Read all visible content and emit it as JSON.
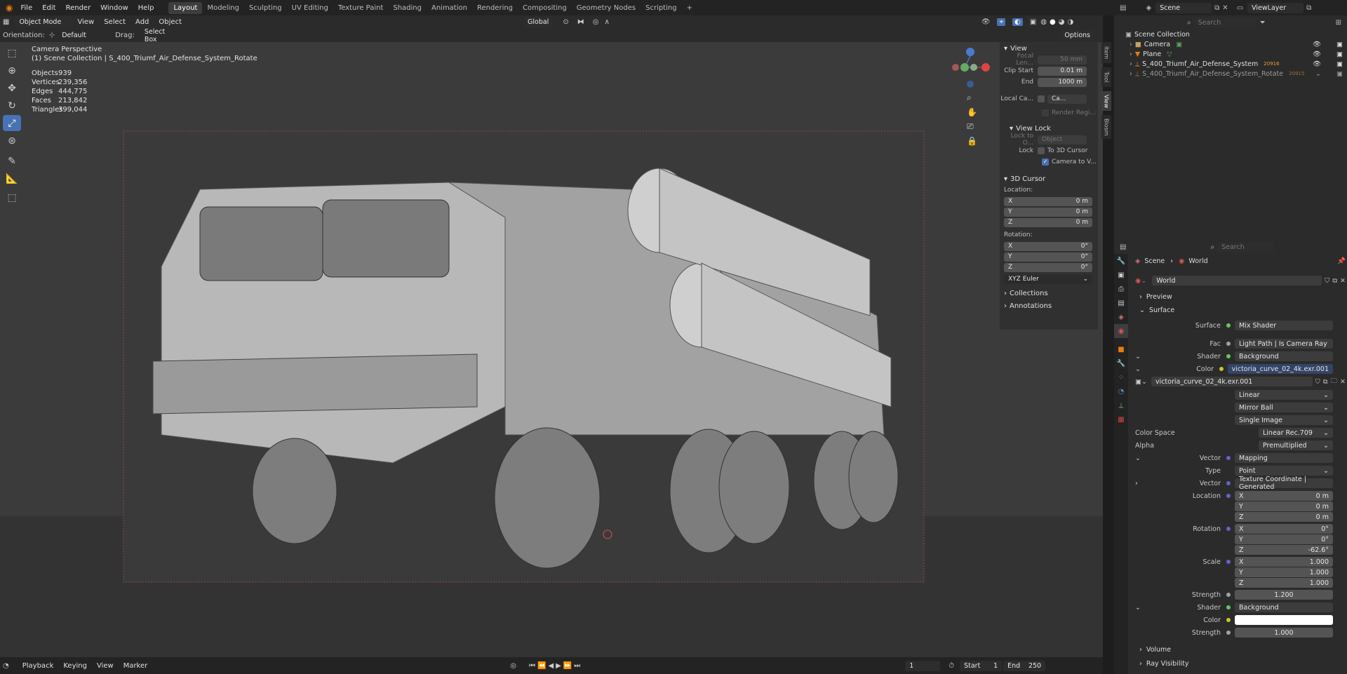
{
  "topbar": {
    "menus": [
      "File",
      "Edit",
      "Render",
      "Window",
      "Help"
    ],
    "workspaces": [
      "Layout",
      "Modeling",
      "Sculpting",
      "UV Editing",
      "Texture Paint",
      "Shading",
      "Animation",
      "Rendering",
      "Compositing",
      "Geometry Nodes",
      "Scripting"
    ],
    "active_workspace": "Layout",
    "scene": "Scene",
    "view_layer": "ViewLayer",
    "search_placeholder": "Search"
  },
  "viewport_header": {
    "mode": "Object Mode",
    "menus": [
      "View",
      "Select",
      "Add",
      "Object"
    ],
    "transform": "Global",
    "orientation_label": "Orientation:",
    "orientation": "Default",
    "drag_label": "Drag:",
    "drag": "Select Box",
    "options": "Options"
  },
  "overlay": {
    "line1": "Camera Perspective",
    "line2": "(1) Scene Collection | S_400_Triumf_Air_Defense_System_Rotate",
    "stats": [
      {
        "label": "Objects",
        "value": "939"
      },
      {
        "label": "Vertices",
        "value": "239,356"
      },
      {
        "label": "Edges",
        "value": "444,775"
      },
      {
        "label": "Faces",
        "value": "213,842"
      },
      {
        "label": "Triangles",
        "value": "399,044"
      }
    ]
  },
  "npanel": {
    "view_title": "View",
    "focal_label": "Focal Len...",
    "focal": "50 mm",
    "clip_start_label": "Clip Start",
    "clip_start": "0.01 m",
    "end_label": "End",
    "end": "1000 m",
    "local_cam_label": "Local Ca...",
    "local_cam_value": "Ca...",
    "render_region": "Render Regi...",
    "view_lock_title": "View Lock",
    "lock_to_label": "Lock to O...",
    "lock_to_value": "Object",
    "lock_label": "Lock",
    "to_3d_cursor": "To 3D Cursor",
    "camera_to_view": "Camera to V...",
    "cursor_title": "3D Cursor",
    "location_label": "Location:",
    "loc": [
      {
        "axis": "X",
        "v": "0 m"
      },
      {
        "axis": "Y",
        "v": "0 m"
      },
      {
        "axis": "Z",
        "v": "0 m"
      }
    ],
    "rotation_label": "Rotation:",
    "rot": [
      {
        "axis": "X",
        "v": "0°"
      },
      {
        "axis": "Y",
        "v": "0°"
      },
      {
        "axis": "Z",
        "v": "0°"
      }
    ],
    "rot_mode": "XYZ Euler",
    "collections": "Collections",
    "annotations": "Annotations",
    "tabs": [
      "Item",
      "Tool",
      "View",
      "Blosm"
    ]
  },
  "outliner": {
    "root": "Scene Collection",
    "items": [
      {
        "name": "Camera"
      },
      {
        "name": "Plane"
      },
      {
        "name": "S_400_Triumf_Air_Defense_System",
        "badge": "20916"
      },
      {
        "name": "S_400_Triumf_Air_Defense_System_Rotate",
        "badge": "20915"
      }
    ]
  },
  "properties": {
    "breadcrumb_scene": "Scene",
    "breadcrumb_world": "World",
    "world_name": "World",
    "preview": "Preview",
    "surface": "Surface",
    "surface_label": "Surface",
    "surface_value": "Mix Shader",
    "fac_label": "Fac",
    "fac_value": "Light Path | Is Camera Ray",
    "shader_label": "Shader",
    "shader_value": "Background",
    "color_label": "Color",
    "color_value": "victoria_curve_02_4k.exr.001",
    "image_name": "victoria_curve_02_4k.exr.001",
    "interp": "Linear",
    "projection": "Mirror Ball",
    "source": "Single Image",
    "color_space_label": "Color Space",
    "color_space": "Linear Rec.709",
    "alpha_label": "Alpha",
    "alpha": "Premultiplied",
    "vector_label": "Vector",
    "vector_value": "Mapping",
    "type_label": "Type",
    "type_value": "Point",
    "vector2_label": "Vector",
    "vector2_value": "Texture Coordinate | Generated",
    "location_label": "Location",
    "loc": [
      {
        "axis": "X",
        "v": "0 m"
      },
      {
        "axis": "Y",
        "v": "0 m"
      },
      {
        "axis": "Z",
        "v": "0 m"
      }
    ],
    "rotation_label": "Rotation",
    "rot": [
      {
        "axis": "X",
        "v": "0°"
      },
      {
        "axis": "Y",
        "v": "0°"
      },
      {
        "axis": "Z",
        "v": "-62.6°"
      }
    ],
    "scale_label": "Scale",
    "scale": [
      {
        "axis": "X",
        "v": "1.000"
      },
      {
        "axis": "Y",
        "v": "1.000"
      },
      {
        "axis": "Z",
        "v": "1.000"
      }
    ],
    "strength_label": "Strength",
    "strength": "1.200",
    "shader2_label": "Shader",
    "shader2_value": "Background",
    "color2_label": "Color",
    "strength2_label": "Strength",
    "strength2": "1.000",
    "volume": "Volume",
    "ray_visibility": "Ray Visibility"
  },
  "timeline": {
    "menus": [
      "Playback",
      "Keying",
      "View",
      "Marker"
    ],
    "frame": "1",
    "start_label": "Start",
    "start": "1",
    "end_label": "End",
    "end": "250"
  },
  "colors": {
    "accent": "#4772b3",
    "socket_green": "#63c763",
    "socket_yellow": "#c7c729",
    "socket_purple": "#6363c7"
  }
}
